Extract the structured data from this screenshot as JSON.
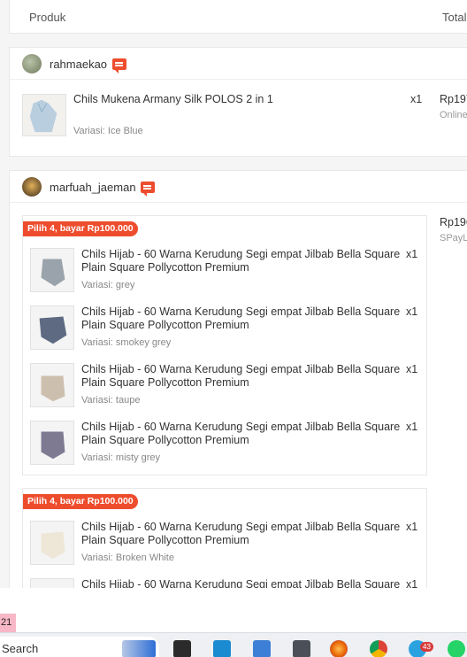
{
  "table_header": {
    "produk": "Produk",
    "total": "Total"
  },
  "orders": [
    {
      "shop": "rahmaekao",
      "product": "Chils Mukena Armany Silk POLOS 2 in 1",
      "variant": "Variasi: Ice Blue",
      "qty": "x1",
      "price": "Rp197",
      "payment": "Online"
    },
    {
      "shop": "marfuah_jaeman",
      "price": "Rp196",
      "payment": "SPayL",
      "bundles": [
        {
          "tag": "Pilih 4, bayar Rp100.000",
          "items": [
            {
              "name": "Chils Hijab - 60 Warna Kerudung Segi empat Jilbab Bella Square Plain Square Pollycotton Premium",
              "variant": "Variasi: grey",
              "qty": "x1"
            },
            {
              "name": "Chils Hijab - 60 Warna Kerudung Segi empat Jilbab Bella Square Plain Square Pollycotton Premium",
              "variant": "Variasi: smokey grey",
              "qty": "x1"
            },
            {
              "name": "Chils Hijab - 60 Warna Kerudung Segi empat Jilbab Bella Square Plain Square Pollycotton Premium",
              "variant": "Variasi: taupe",
              "qty": "x1"
            },
            {
              "name": "Chils Hijab - 60 Warna Kerudung Segi empat Jilbab Bella Square Plain Square Pollycotton Premium",
              "variant": "Variasi: misty grey",
              "qty": "x1"
            }
          ]
        },
        {
          "tag": "Pilih 4, bayar Rp100.000",
          "items": [
            {
              "name": "Chils Hijab - 60 Warna Kerudung Segi empat Jilbab Bella Square Plain Square Pollycotton Premium",
              "variant": "Variasi: Broken White",
              "qty": "x1"
            },
            {
              "name": "Chils Hijab - 60 Warna Kerudung Segi empat Jilbab Bella Square",
              "variant": "",
              "qty": "x1"
            }
          ]
        }
      ]
    }
  ],
  "page_indicator": "21",
  "taskbar": {
    "search_label": "Search",
    "notification_count": "43",
    "icons": [
      "widgets-icon",
      "file-explorer-icon",
      "desktop-icon",
      "notepad-icon",
      "calculator-icon",
      "firefox-icon",
      "chrome-icon",
      "telegram-icon",
      "whatsapp-icon"
    ]
  },
  "colors": {
    "accent": "#ee4d2d",
    "page_bg": "#f5f5f5"
  }
}
